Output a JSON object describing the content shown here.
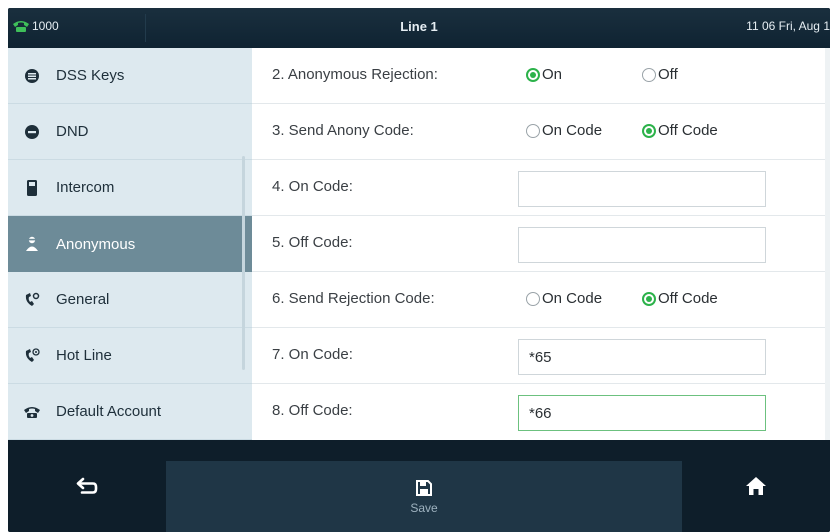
{
  "status_bar": {
    "line_number": "1000",
    "title": "Line 1",
    "datetime": "11 06 Fri, Aug 1",
    "phone_icon": "phone-icon"
  },
  "sidebar": {
    "items": [
      {
        "label": "DSS Keys",
        "icon": "dss-keys-icon",
        "active": false
      },
      {
        "label": "DND",
        "icon": "dnd-icon",
        "active": false
      },
      {
        "label": "Intercom",
        "icon": "intercom-icon",
        "active": false
      },
      {
        "label": "Anonymous",
        "icon": "anonymous-icon",
        "active": true
      },
      {
        "label": "General",
        "icon": "general-icon",
        "active": false
      },
      {
        "label": "Hot Line",
        "icon": "hot-line-icon",
        "active": false
      },
      {
        "label": "Default Account",
        "icon": "default-account-icon",
        "active": false
      }
    ]
  },
  "settings": {
    "anonymous_rejection": {
      "label": "2. Anonymous Rejection:",
      "options": [
        "On",
        "Off"
      ],
      "selected": "On"
    },
    "send_anony_code": {
      "label": "3. Send Anony Code:",
      "options": [
        "On Code",
        "Off Code"
      ],
      "selected": "Off Code"
    },
    "on_code_4": {
      "label": "4. On Code:",
      "value": ""
    },
    "off_code_5": {
      "label": "5. Off Code:",
      "value": ""
    },
    "send_rejection_code": {
      "label": "6. Send Rejection Code:",
      "options": [
        "On Code",
        "Off Code"
      ],
      "selected": "Off Code"
    },
    "on_code_7": {
      "label": "7. On Code:",
      "value": "*65"
    },
    "off_code_8": {
      "label": "8. Off Code:",
      "value": "*66"
    }
  },
  "bottom_bar": {
    "back_icon": "back-icon",
    "save_label": "Save",
    "save_icon": "save-icon",
    "home_icon": "home-icon"
  },
  "colors": {
    "accent_green": "#2cb24a",
    "active_sidebar": "#6d8b98",
    "bar_background": "#0e1e2a"
  }
}
